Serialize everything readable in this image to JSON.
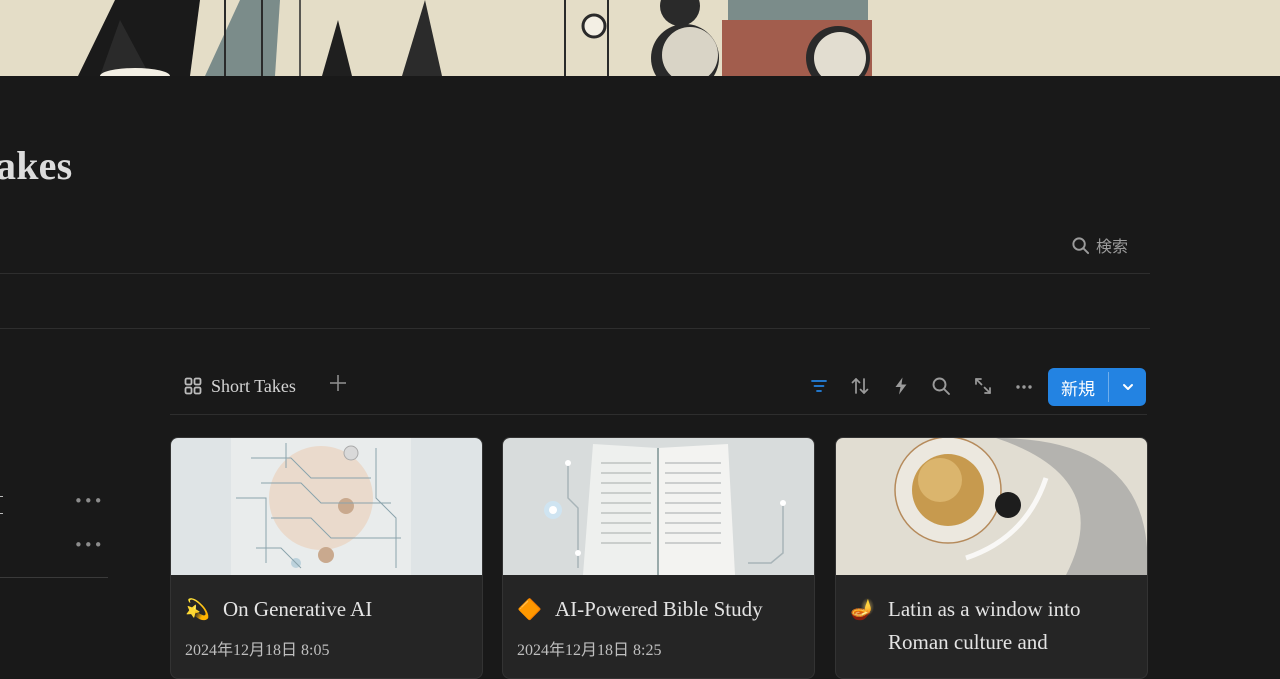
{
  "page": {
    "title": "akes",
    "search_label": "検索"
  },
  "view": {
    "tab_label": "Short Takes",
    "new_button_label": "新規"
  },
  "sidebar": {
    "more_glyph": "•••"
  },
  "icons": {
    "search": "search-icon",
    "gallery": "gallery-icon",
    "add": "plus-icon",
    "filter": "filter-icon",
    "sort": "sort-icon",
    "automation": "lightning-icon",
    "expand": "expand-icon",
    "more": "more-icon",
    "dropdown": "chevron-down-icon"
  },
  "colors": {
    "background": "#191919",
    "accent": "#2383e2",
    "card": "#252525"
  },
  "cards": [
    {
      "emoji": "💫",
      "title": "On Generative AI",
      "date": "2024年12月18日 8:05"
    },
    {
      "emoji": "🔶",
      "title": "AI-Powered Bible Study",
      "date": "2024年12月18日 8:25"
    },
    {
      "emoji": "🪔",
      "title": "Latin as a window into Roman culture and",
      "date": ""
    }
  ]
}
